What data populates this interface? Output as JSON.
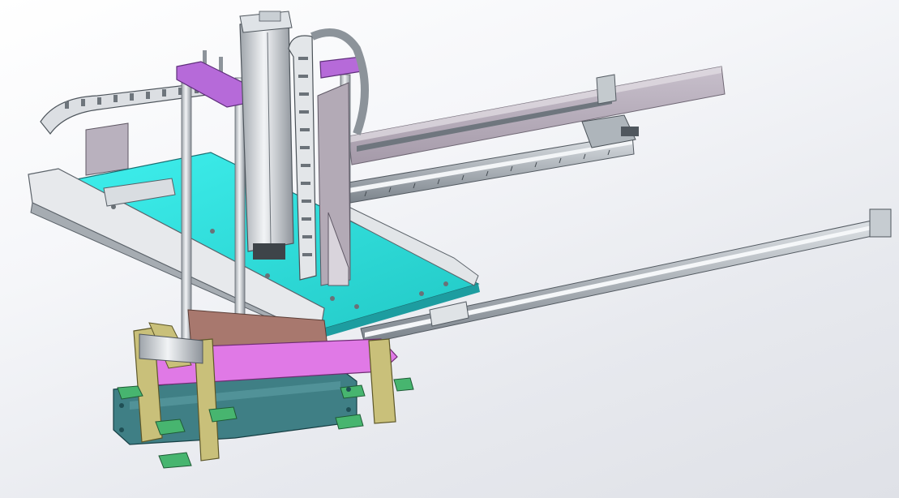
{
  "viewport": {
    "background_top": "#ffffff",
    "background_bottom": "#dfe1e7"
  },
  "model": {
    "part_colors": {
      "base_plate": "#2fe3e0",
      "bracket_purple": "#b66ad9",
      "clamp_magenta": "#e079e6",
      "frame_olive": "#c9c07a",
      "base_teal": "#3f7f85",
      "pad_green": "#47b56f",
      "rail_grey": "#9aa3ab",
      "cover_lilac": "#b7aebb",
      "steel": "#c8cdd2"
    }
  }
}
